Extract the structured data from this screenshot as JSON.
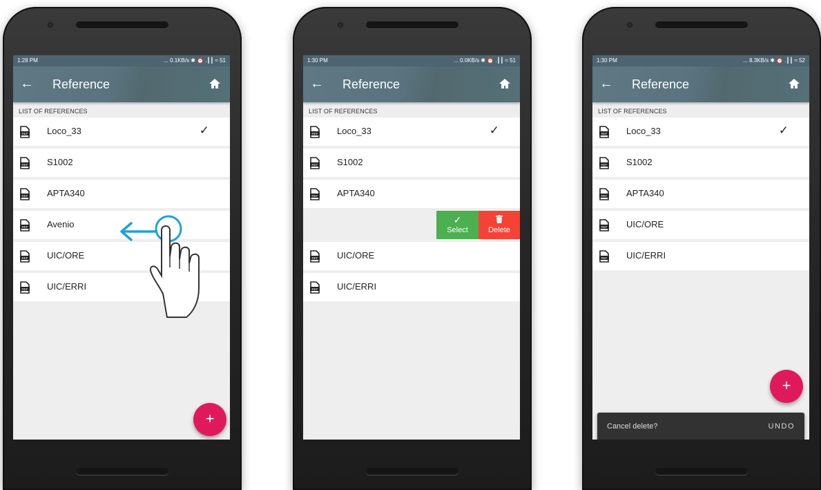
{
  "phones": [
    {
      "status_time": "1:28 PM",
      "status_right": "... 0.1KB/s ✱ ⏰ .┃┃ ≈ 51",
      "back_icon": "arrow-left-icon",
      "title": "Reference",
      "home_icon": "home-icon",
      "section_header": "LIST OF REFERENCES",
      "items": [
        {
          "label": "Loco_33",
          "selected": true
        },
        {
          "label": "S1002"
        },
        {
          "label": "APTA340"
        },
        {
          "label": "Avenio"
        },
        {
          "label": "UIC/ORE"
        },
        {
          "label": "UIC/ERRI"
        }
      ],
      "fab_label": "+"
    },
    {
      "status_time": "1:30 PM",
      "status_right": "... 0.0KB/s ✱ ⏰ .┃┃ ≈ 51",
      "title": "Reference",
      "section_header": "LIST OF REFERENCES",
      "items_top": [
        {
          "label": "Loco_33",
          "selected": true
        },
        {
          "label": "S1002"
        },
        {
          "label": "APTA340"
        }
      ],
      "swipe_actions": {
        "select_label": "Select",
        "delete_label": "Delete"
      },
      "items_bottom": [
        {
          "label": "UIC/ORE"
        },
        {
          "label": "UIC/ERRI"
        }
      ]
    },
    {
      "status_time": "1:30 PM",
      "status_right": "... 8.3KB/s ✱ ⏰ .┃┃ ≈ 52",
      "title": "Reference",
      "section_header": "LIST OF REFERENCES",
      "items": [
        {
          "label": "Loco_33",
          "selected": true
        },
        {
          "label": "S1002"
        },
        {
          "label": "APTA340"
        },
        {
          "label": "UIC/ORE"
        },
        {
          "label": "UIC/ERRI"
        }
      ],
      "fab_label": "+",
      "snackbar": {
        "message": "Cancel delete?",
        "action": "UNDO"
      }
    }
  ],
  "check_mark": "✓",
  "colors": {
    "appbar": "#5b7480",
    "statusbar": "#4d6571",
    "fab": "#e0195d",
    "select_action": "#4caf50",
    "delete_action": "#f44336",
    "snackbar": "#323232",
    "swipe_arrow": "#1ea1d6"
  },
  "gesture_icon": "swipe-left-hand-icon"
}
